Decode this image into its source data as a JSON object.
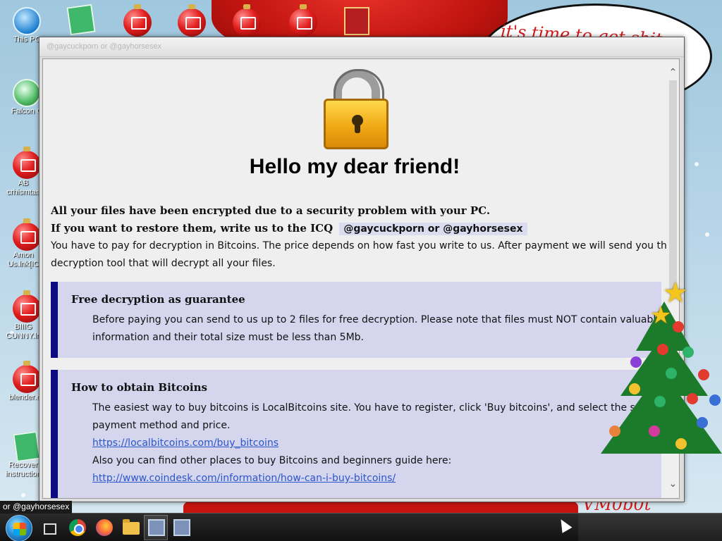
{
  "desktop": {
    "background_texts": {
      "speech_bubble": "it's time to get shit",
      "bottom_right": "VM0b0t"
    },
    "icons": [
      {
        "label": "This PC",
        "icon": "computer-monitor-icon"
      },
      {
        "label": "Falcon C",
        "icon": "recycle-bin-icon"
      },
      {
        "label": "AB crhismtas",
        "icon": "ornament-icon"
      },
      {
        "label": "Amon Us.lnk[IC",
        "icon": "ornament-icon"
      },
      {
        "label": "BIIIG CUNNY.ln",
        "icon": "ornament-icon"
      },
      {
        "label": "blender.ex",
        "icon": "ornament-icon"
      },
      {
        "label": "Recover instruction",
        "icon": "document-icon"
      }
    ]
  },
  "window": {
    "title": "@gaycuckporn or @gayhorsesex",
    "heading": "Hello my dear friend!",
    "intro_bold_1": "All your files have been encrypted due to a security problem with your PC.",
    "intro_bold_2": "If you want to restore them, write us to the ICQ",
    "icq_handle": "@gaycuckporn or @gayhorsesex",
    "intro_line_1": "You have to pay for decryption in Bitcoins. The price depends on how fast you write to us. After payment we will send you the",
    "intro_line_2": "decryption tool that will decrypt all your files.",
    "boxes": [
      {
        "title": "Free decryption as guarantee",
        "lines": [
          "Before paying you can send to us up to 2 files for free decryption. Please note that files must NOT contain valuable",
          "information and their total size must be less than 5Mb."
        ]
      },
      {
        "title": "How to obtain Bitcoins",
        "lines": [
          "The easiest way to buy bitcoins is LocalBitcoins site. You have to register, click 'Buy bitcoins', and select the seller by",
          "payment method and price."
        ],
        "link_1": "https://localbitcoins.com/buy_bitcoins",
        "line_3": "Also you can find other places to buy Bitcoins and beginners guide here:",
        "link_2": "http://www.coindesk.com/information/how-can-i-buy-bitcoins/"
      }
    ]
  },
  "taskbar": {
    "active_window_title": "or @gayhorsesex",
    "apps": [
      "chrome-icon",
      "firefox-icon",
      "folder-icon",
      "app-window-icon",
      "app-window-icon"
    ]
  },
  "colors": {
    "box_bg": "#d5d5ee",
    "box_accent": "#0b0b7f",
    "link": "#2a57c9"
  }
}
